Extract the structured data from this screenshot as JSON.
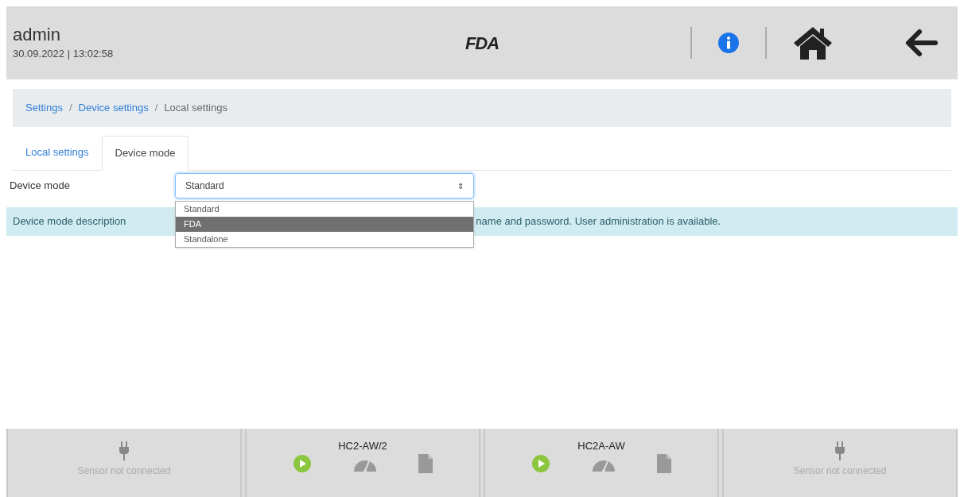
{
  "header": {
    "user": "admin",
    "datetime": "30.09.2022 | 13:02:58",
    "logo": "FDA"
  },
  "breadcrumb": [
    {
      "label": "Settings",
      "link": true
    },
    {
      "label": "Device settings",
      "link": true
    },
    {
      "label": "Local settings",
      "link": false
    }
  ],
  "breadcrumb_separator": "/",
  "tabs": [
    {
      "label": "Local settings",
      "selected": false
    },
    {
      "label": "Device mode",
      "selected": true
    }
  ],
  "device_mode": {
    "label": "Device mode",
    "value": "Standard",
    "caret": "⇕",
    "expanded": true,
    "options": [
      {
        "label": "Standard",
        "highlighted": false
      },
      {
        "label": "FDA",
        "highlighted": true
      },
      {
        "label": "Standalone",
        "highlighted": false
      }
    ]
  },
  "description": {
    "visible_start": "Device mode description",
    "visible_end": "name and password. User administration is available."
  },
  "sensors": [
    {
      "kind": "disconnected",
      "text": "Sensor not connected"
    },
    {
      "kind": "probe",
      "name": "HC2-AW/2"
    },
    {
      "kind": "probe",
      "name": "HC2A-AW"
    },
    {
      "kind": "disconnected",
      "text": "Sensor not connected"
    }
  ]
}
